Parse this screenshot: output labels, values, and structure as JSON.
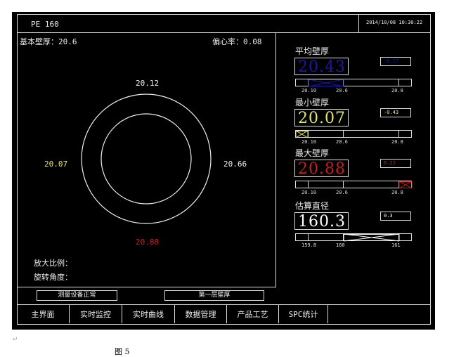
{
  "header": {
    "product": "PE 160",
    "datetime": "2014/10/08 10:30:22"
  },
  "left": {
    "base_label": "基本壁厚：20.6",
    "ecc_label": "偏心率：0.08",
    "top": "20.12",
    "left": "20.07",
    "right": "20.66",
    "bottom": "20.88",
    "zoom_label": "放大比例：",
    "rotate_label": "旋转角度："
  },
  "status": {
    "device": "测量设备正常",
    "layer": "第一层壁厚"
  },
  "sections": [
    {
      "title": "平均壁厚",
      "value": "20.43",
      "delta": "-0.17",
      "color": "#1a1aa8",
      "ticks": [
        "20.10",
        "20.6",
        "20.8"
      ]
    },
    {
      "title": "最小壁厚",
      "value": "20.07",
      "delta": "-0.43",
      "color": "#e6e66a",
      "ticks": [
        "20.10",
        "20.6",
        "20.8"
      ]
    },
    {
      "title": "最大壁厚",
      "value": "20.88",
      "delta": "0.22",
      "color": "#c81e1e",
      "ticks": [
        "20.10",
        "20.6",
        "20.8"
      ]
    },
    {
      "title": "估算直径",
      "value": "160.3",
      "delta": "0.3",
      "color": "#ffffff",
      "ticks": [
        "159.8",
        "160",
        "161"
      ]
    }
  ],
  "nav": [
    "主界面",
    "实时监控",
    "实时曲线",
    "数据管理",
    "产品工艺",
    "SPC统计"
  ],
  "caption": "图 5"
}
